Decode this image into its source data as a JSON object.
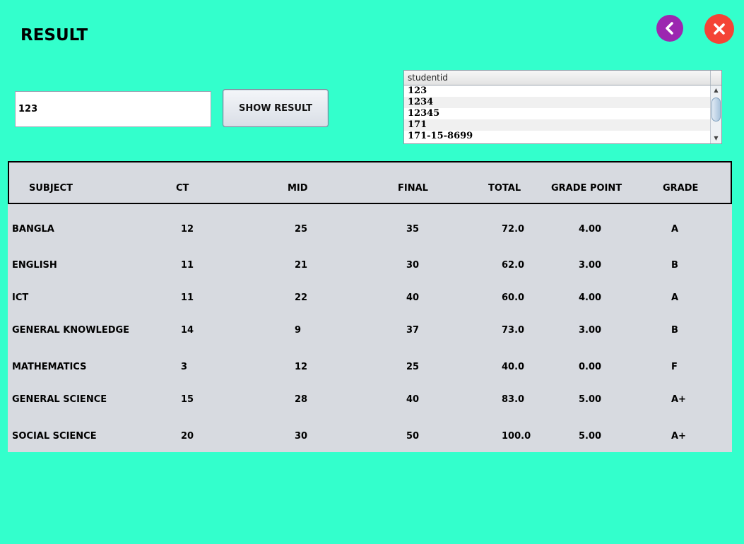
{
  "header": {
    "title": "RESULT"
  },
  "controls": {
    "student_id_value": "123",
    "show_result_label": "SHOW RESULT"
  },
  "student_list": {
    "column_header": "studentid",
    "items": [
      "123",
      "1234",
      "12345",
      "171",
      "171-15-8699"
    ]
  },
  "results_table": {
    "columns": [
      "SUBJECT",
      "CT",
      "MID",
      "FINAL",
      "TOTAL",
      "GRADE POINT",
      "GRADE"
    ],
    "rows": [
      [
        "BANGLA",
        "12",
        "25",
        "35",
        "72.0",
        "4.00",
        "A"
      ],
      [
        "ENGLISH",
        "11",
        "21",
        "30",
        "62.0",
        "3.00",
        "B"
      ],
      [
        "ICT",
        "11",
        "22",
        "40",
        "60.0",
        "4.00",
        "A"
      ],
      [
        "GENERAL KNOWLEDGE",
        "14",
        "9",
        "37",
        "73.0",
        "3.00",
        "B"
      ],
      [
        "MATHEMATICS",
        "3",
        "12",
        "25",
        "40.0",
        "0.00",
        "F"
      ],
      [
        "GENERAL SCIENCE",
        "15",
        "28",
        "40",
        "83.0",
        "5.00",
        "A+"
      ],
      [
        "SOCIAL SCIENCE",
        "20",
        "30",
        "50",
        "100.0",
        "5.00",
        "A+"
      ]
    ]
  },
  "icons": {
    "back": "chevron-left-icon",
    "close": "close-icon"
  },
  "colors": {
    "background": "#33ffcc",
    "back_button": "#9c27b0",
    "close_button": "#f44336",
    "table_background": "#d7dae0"
  }
}
